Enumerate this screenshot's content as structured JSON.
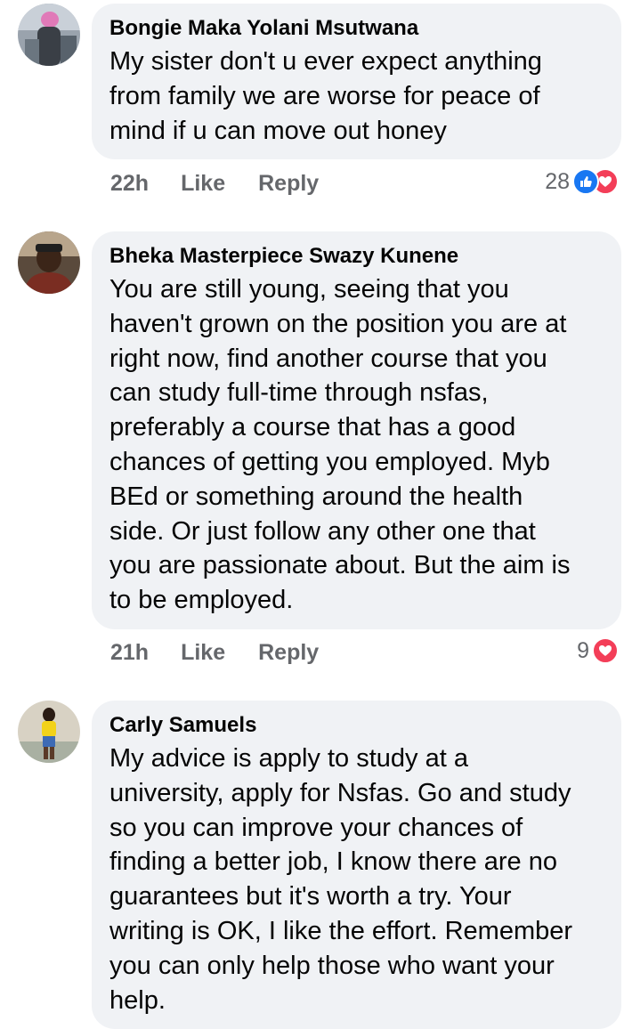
{
  "colors": {
    "bubble_bg": "#f0f2f5",
    "meta_text": "#65676b",
    "like_blue": "#1877f2",
    "love_red": "#f33e58"
  },
  "comments": [
    {
      "author": "Bongie Maka Yolani Msutwana",
      "text": "My sister don't u ever expect    anything\nfrom family we are worse for peace of\nmind if u can move out honey",
      "time": "22h",
      "like_label": "Like",
      "reply_label": "Reply",
      "reaction_count": "28",
      "reactions": [
        "like-icon",
        "love-icon"
      ]
    },
    {
      "author": "Bheka Masterpiece Swazy Kunene",
      "text": "You are still young, seeing that you\nhaven't grown on the position you are at\nright now, find another course that you\ncan study full-time through nsfas,\npreferably a course that has a good\nchances of getting you employed. Myb\nBEd or something around the health\nside. Or just follow any other one that\nyou are passionate about. But the aim is\nto be employed.",
      "time": "21h",
      "like_label": "Like",
      "reply_label": "Reply",
      "reaction_count": "9",
      "reactions": [
        "love-icon"
      ]
    },
    {
      "author": "Carly Samuels",
      "text": "My advice is apply to study at a\nuniversity, apply for Nsfas. Go and study\nso you can improve your chances of\nfinding a better job, I know there are no\nguarantees but it's worth a try. Your\nwriting is OK, I like the effort. Remember\nyou can only help those who want your\nhelp.",
      "time": "",
      "like_label": "",
      "reply_label": "",
      "reaction_count": "",
      "reactions": []
    }
  ]
}
